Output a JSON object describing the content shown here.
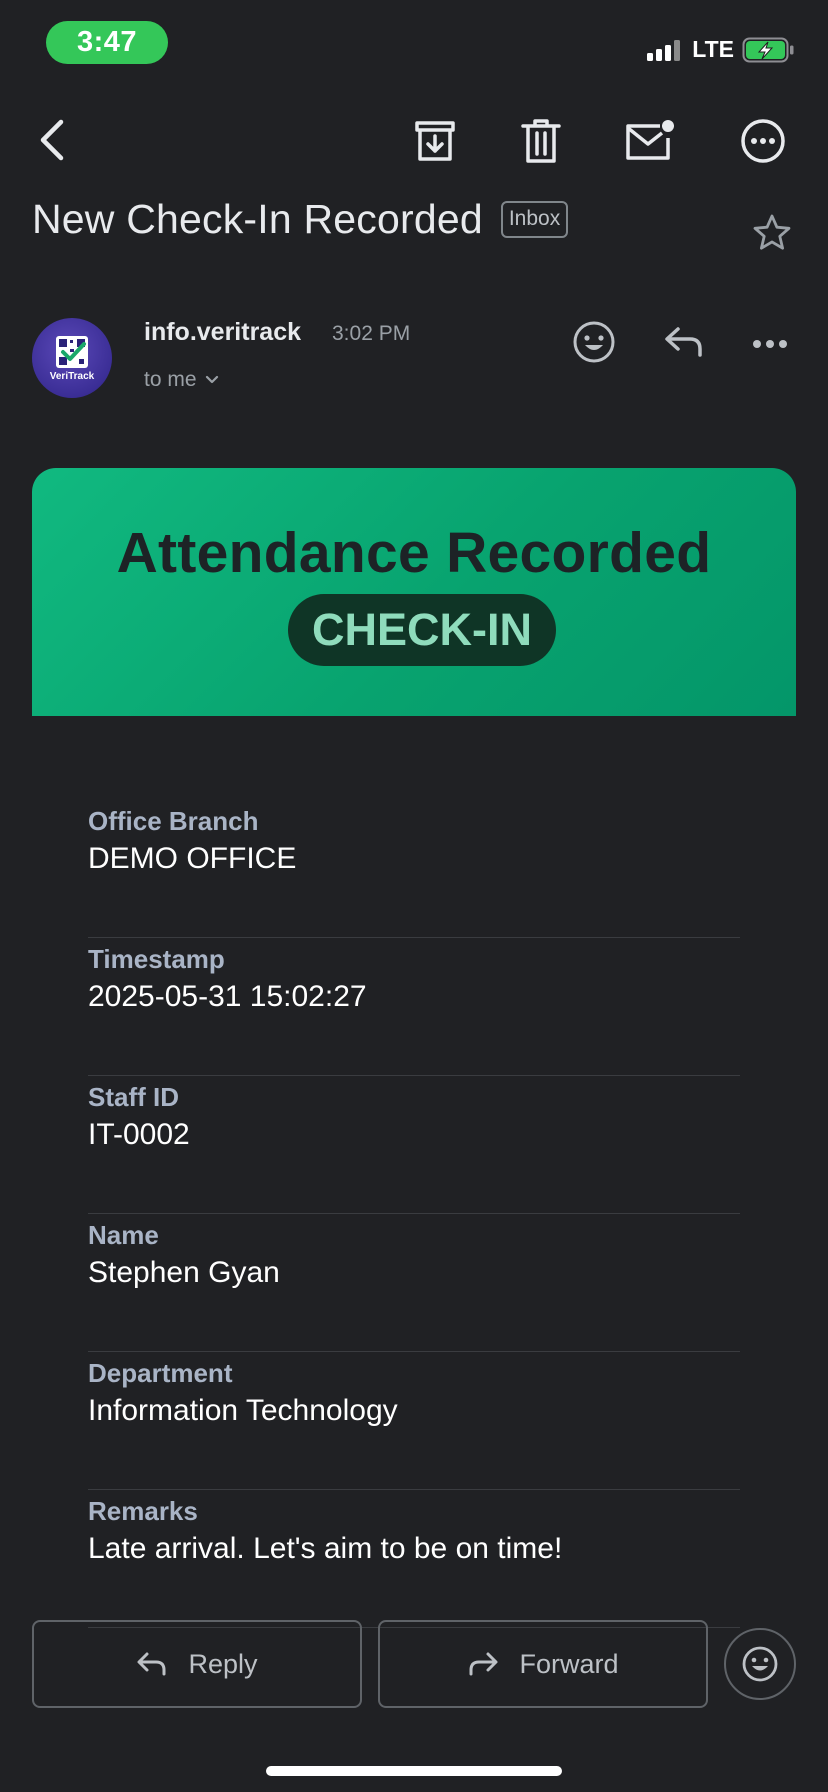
{
  "status_bar": {
    "time": "3:47",
    "network": "LTE"
  },
  "email": {
    "subject": "New Check-In Recorded",
    "label": "Inbox",
    "sender": {
      "name": "info.veritrack",
      "time": "3:02 PM",
      "recipient": "to me",
      "avatar_text": "VeriTrack"
    },
    "banner": {
      "title": "Attendance Recorded",
      "pill": "CHECK-IN",
      "color": "#0ea572"
    },
    "details": [
      {
        "label": "Office Branch",
        "value": "DEMO OFFICE"
      },
      {
        "label": "Timestamp",
        "value": "2025-05-31 15:02:27"
      },
      {
        "label": "Staff ID",
        "value": "IT-0002"
      },
      {
        "label": "Name",
        "value": "Stephen Gyan"
      },
      {
        "label": "Department",
        "value": "Information Technology"
      },
      {
        "label": "Remarks",
        "value": "Late arrival. Let's aim to be on time!"
      }
    ]
  },
  "actions": {
    "reply": "Reply",
    "forward": "Forward"
  },
  "icons": {
    "back": "chevron-left-icon",
    "archive": "archive-icon",
    "delete": "trash-icon",
    "mark_unread": "mail-unread-icon",
    "more": "more-circle-icon",
    "star": "star-icon",
    "emoji": "emoji-icon",
    "reply": "reply-icon",
    "more_horizontal": "more-horizontal-icon",
    "forward": "forward-icon"
  }
}
